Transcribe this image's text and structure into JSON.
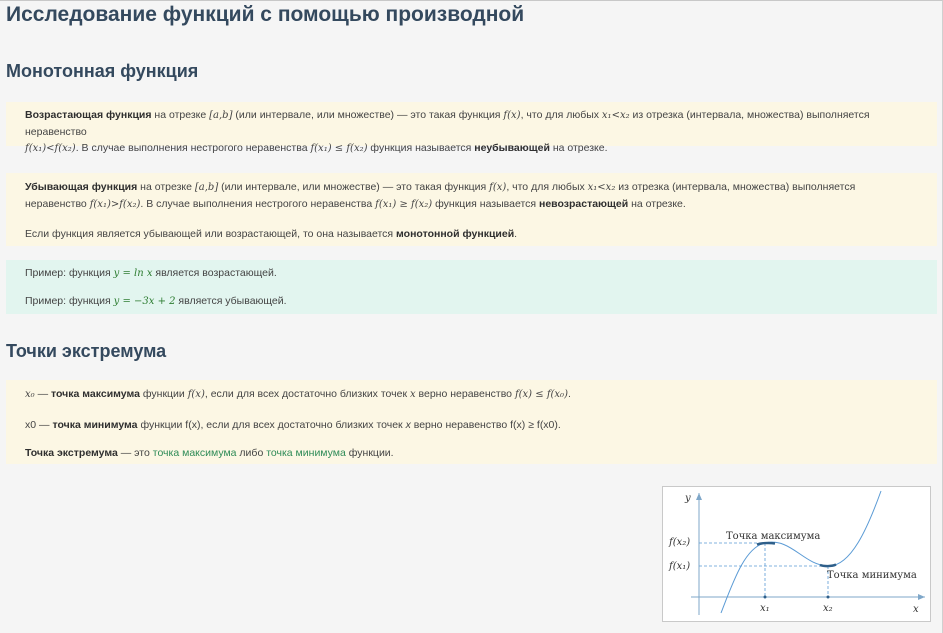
{
  "page_title": "Исследование функций с помощью производной",
  "section_monotone": {
    "heading": "Монотонная функция",
    "increasing": {
      "term": "Возрастающая функция",
      "t1": " на отрезке ",
      "seg": "[a,b]",
      "t2": " (или интервале, или множестве) — это такая функция ",
      "fx": "f(x)",
      "t3": ", что для любых ",
      "cond": "x₁<x₂",
      "t4": " из отрезка (интервала, множества) выполняется неравенство",
      "ineq": "f(x₁)<f(x₂)",
      "t5": ". В случае выполнения нестрогого неравенства ",
      "ineq2": "f(x₁) ≤ f(x₂)",
      "t6": " функция называется ",
      "term2": "неубывающей",
      "t7": " на отрезке."
    },
    "decreasing": {
      "term": "Убывающая функция",
      "t1": " на отрезке ",
      "seg": "[a,b]",
      "t2": " (или интервале, или множестве) — это такая функция ",
      "fx": "f(x)",
      "t3": ", что для любых ",
      "cond": "x₁<x₂",
      "t4": " из отрезка (интервала, множества) выполняется",
      "t4b": "неравенство ",
      "ineq": "f(x₁)>f(x₂)",
      "t5": ". В случае выполнения нестрогого неравенства ",
      "ineq2": "f(x₁) ≥ f(x₂)",
      "t6": " функция называется ",
      "term2": "невозрастающей",
      "t7": " на отрезке."
    },
    "monotone_note": {
      "t1": "Если функция является убывающей или возрастающей, то она называется ",
      "term": "монотонной функцией",
      "t2": "."
    },
    "examples": [
      {
        "t1": "Пример: функция ",
        "formula": "y = ln x",
        "t2": " является возрастающей."
      },
      {
        "t1": "Пример: функция ",
        "formula": "y = −3x + 2",
        "t2": " является убывающей."
      }
    ]
  },
  "section_extremum": {
    "heading": "Точки экстремума",
    "max_def": {
      "x0": "x₀",
      "t1": " — ",
      "term": "точка максимума",
      "t2": " функции ",
      "fx": "f(x)",
      "t3": ", если для всех достаточно близких точек ",
      "x": "x",
      "t4": " верно неравенство ",
      "ineq": "f(x) ≤ f(x₀)",
      "t5": "."
    },
    "min_def": {
      "x0": "x0",
      "t1": " — ",
      "term": "точка минимума",
      "t2": " функции ",
      "fx": "f(x)",
      "t3": ", если для всех достаточно близких точек ",
      "x": "x",
      "t4": " верно неравенство ",
      "ineq": "f(x) ≥ f(x0)",
      "t5": "."
    },
    "extremum_def": {
      "term": "Точка экстремума",
      "t1": " — это ",
      "link_max": "точка максимума",
      "t2": " либо ",
      "link_min": "точка минимума",
      "t3": " функции."
    }
  },
  "figure": {
    "y_axis": "y",
    "x_axis": "x",
    "fx2": "f(x₂)",
    "fx1": "f(x₁)",
    "x1": "x₁",
    "x2": "x₂",
    "max_label": "Точка максимума",
    "min_label": "Точка минимума"
  },
  "colors": {
    "heading": "#34495e",
    "definition_bg": "#fcf7e4",
    "example_bg": "#e2f5ef",
    "link": "#2e8b57",
    "curve": "#5b9bd5"
  }
}
